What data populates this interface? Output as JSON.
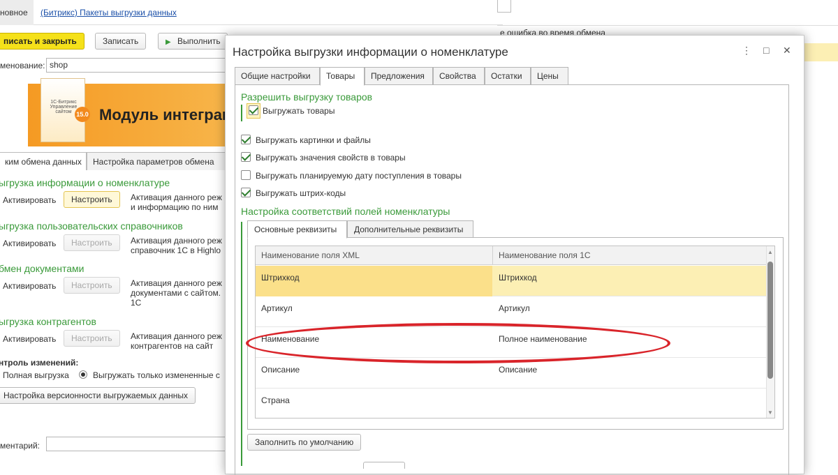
{
  "background_window": {
    "top_tab_active": "новное",
    "top_tab_link": "(Битрикс) Пакеты выгрузки данных",
    "toolbar": {
      "save_close": "писать и закрыть",
      "save": "Записать",
      "run": "Выполнить"
    },
    "name_label": "менование:",
    "name_value": "shop",
    "banner": {
      "title": "Модуль интеграц",
      "badge": "15.0",
      "box_text": "1С-Битрикс Управление сайтом"
    },
    "tabs": [
      "ким обмена данных",
      "Настройка параметров обмена"
    ],
    "sections": [
      {
        "title": "ыгрузка информации о номенклатуре",
        "activate": "Активировать",
        "configure": "Настроить",
        "desc": "Активация данного реж и информацию по ним",
        "enabled": true
      },
      {
        "title": "ыгрузка пользовательских справочников",
        "activate": "Активировать",
        "configure": "Настроить",
        "desc": "Активация данного реж справочник 1С в Highlo",
        "enabled": false
      },
      {
        "title": "бмен документами",
        "activate": "Активировать",
        "configure": "Настроить",
        "desc": "Активация данного реж документами с сайтом. 1С",
        "enabled": false
      },
      {
        "title": "ыгрузка контрагентов",
        "activate": "Активировать",
        "configure": "Настроить",
        "desc": "Активация данного реж контрагентов на сайт",
        "enabled": false
      }
    ],
    "changes_label": "нтроль изменений:",
    "radio_full": "Полная выгрузка",
    "radio_changed": "Выгружать только измененные с",
    "versioning_button": "Настройка версионности выгружаемых данных",
    "comment_label": "ментарий:",
    "right_status": "е ошибка во время обмена"
  },
  "dialog": {
    "title": "Настройка выгрузки информации о номенклатуре",
    "controls": {
      "more": "⋮",
      "maximize": "□",
      "close": "✕"
    },
    "tabs": [
      "Общие настройки",
      "Товары",
      "Предложения",
      "Свойства",
      "Остатки",
      "Цены"
    ],
    "active_tab": "Товары",
    "allow_header": "Разрешить выгрузку товаров",
    "checkboxes": [
      {
        "label": "Выгружать товары",
        "checked": true
      },
      {
        "label": "Выгружать картинки и файлы",
        "checked": true
      },
      {
        "label": "Выгружать значения свойств в товары",
        "checked": true
      },
      {
        "label": "Выгружать планируемую дату поступления в товары",
        "checked": false
      },
      {
        "label": "Выгружать штрих-коды",
        "checked": true
      }
    ],
    "mapping_header": "Настройка соответствий полей номенклатуры",
    "inner_tabs": [
      "Основные реквизиты",
      "Дополнительные реквизиты"
    ],
    "grid": {
      "columns": [
        "Наименование поля XML",
        "Наименование поля 1С"
      ],
      "rows": [
        [
          "Штрихкод",
          "Штрихкод"
        ],
        [
          "Артикул",
          "Артикул"
        ],
        [
          "Наименование",
          "Полное наименование"
        ],
        [
          "Описание",
          "Описание"
        ],
        [
          "Страна",
          ""
        ]
      ]
    },
    "fill_default_button": "Заполнить по умолчанию"
  },
  "colors": {
    "accent_green": "#3a9a3a",
    "selection_yellow": "#fcefb4",
    "primary_button": "#f5e11a",
    "annotation_red": "#d9242a"
  }
}
